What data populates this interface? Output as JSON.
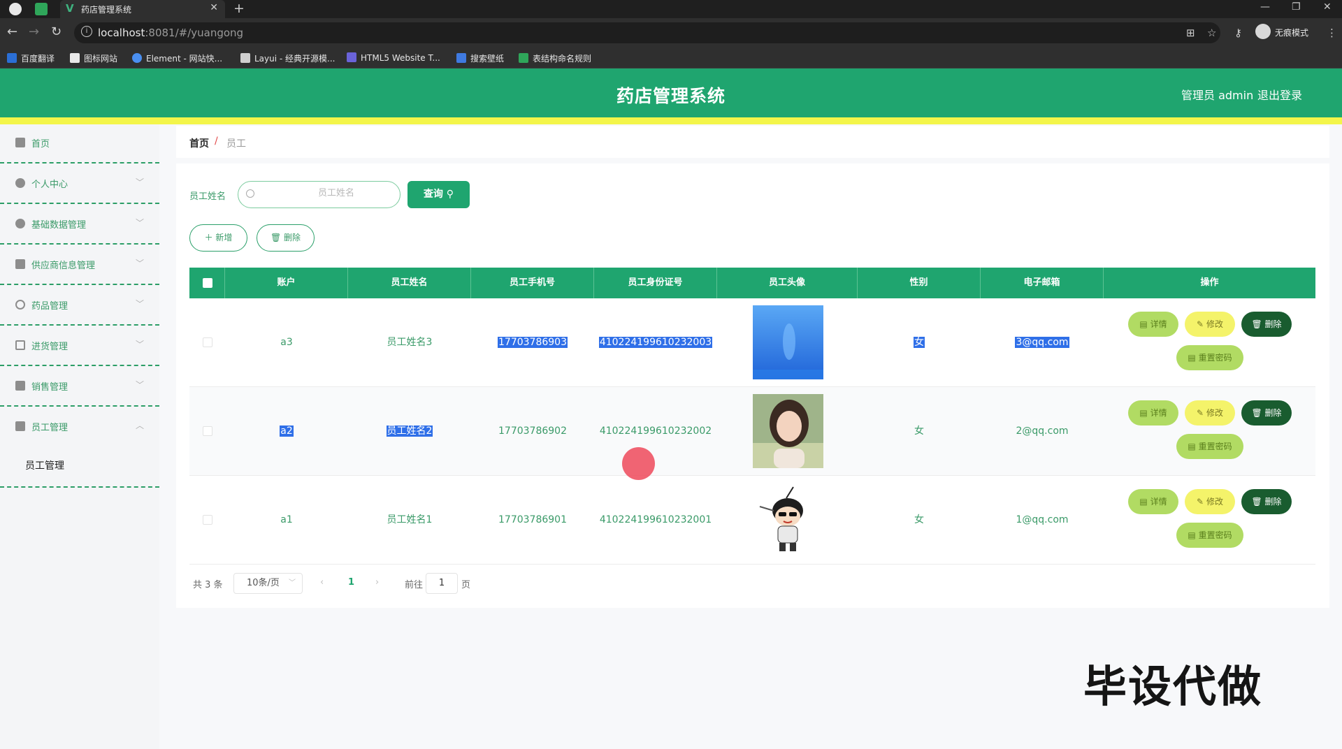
{
  "browser": {
    "tab_title": "药店管理系统",
    "url_host": "localhost",
    "url_rest": ":8081/#/yuangong",
    "incognito_label": "无痕模式",
    "bookmarks": [
      "百度翻译",
      "图标网站",
      "Element - 网站快...",
      "Layui - 经典开源模...",
      "HTML5 Website T...",
      "搜索壁纸",
      "表结构命名规则"
    ]
  },
  "header": {
    "title": "药店管理系统",
    "admin_label": "管理员 admin",
    "logout_label": "退出登录"
  },
  "sidebar": {
    "items": [
      {
        "label": "首页",
        "icon": "home-icon"
      },
      {
        "label": "个人中心",
        "icon": "user-icon"
      },
      {
        "label": "基础数据管理",
        "icon": "pin-icon"
      },
      {
        "label": "供应商信息管理",
        "icon": "monitor-icon"
      },
      {
        "label": "药品管理",
        "icon": "globe-icon"
      },
      {
        "label": "进货管理",
        "icon": "chat-icon"
      },
      {
        "label": "销售管理",
        "icon": "clipboard-icon"
      },
      {
        "label": "员工管理",
        "icon": "folder-icon"
      }
    ],
    "submenu_label": "员工管理"
  },
  "breadcrumb": {
    "home": "首页",
    "separator": "/",
    "current": "员工"
  },
  "search": {
    "label": "员工姓名",
    "placeholder": "员工姓名",
    "query_label": "查询"
  },
  "actions": {
    "add_label": "新增",
    "delete_label": "删除"
  },
  "table": {
    "headers": [
      "账户",
      "员工姓名",
      "员工手机号",
      "员工身份证号",
      "员工头像",
      "性别",
      "电子邮箱",
      "操作"
    ],
    "rows": [
      {
        "account": "a3",
        "name": "员工姓名3",
        "phone": "17703786903",
        "idcard": "410224199610232003",
        "gender": "女",
        "email": "3@qq.com"
      },
      {
        "account": "a2",
        "name": "员工姓名2",
        "phone": "17703786902",
        "idcard": "410224199610232002",
        "gender": "女",
        "email": "2@qq.com"
      },
      {
        "account": "a1",
        "name": "员工姓名1",
        "phone": "17703786901",
        "idcard": "410224199610232001",
        "gender": "女",
        "email": "1@qq.com"
      }
    ],
    "op_labels": {
      "detail": "详情",
      "edit": "修改",
      "delete": "删除",
      "reset": "重置密码"
    }
  },
  "pagination": {
    "total": "共 3 条",
    "page_size": "10条/页",
    "current_page": "1",
    "goto_prefix": "前往",
    "goto_value": "1",
    "goto_suffix": "页"
  },
  "watermark": "毕设代做",
  "colors": {
    "primary": "#1fa56f",
    "stripe": "#f3f54a",
    "selection": "#2f6fe8"
  }
}
